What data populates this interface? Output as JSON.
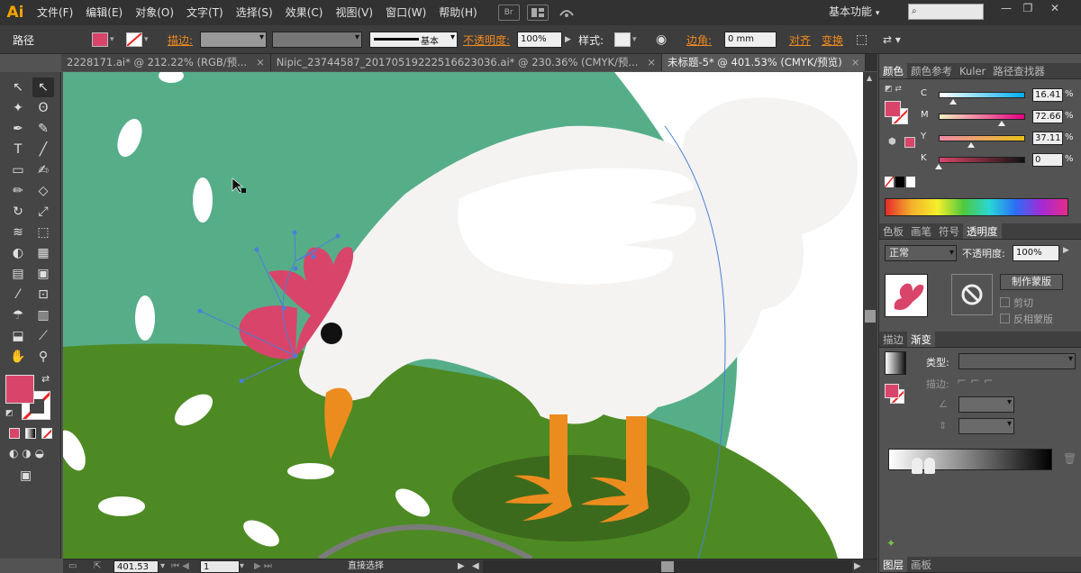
{
  "app": {
    "logo": "Ai"
  },
  "menu": [
    "文件(F)",
    "编辑(E)",
    "对象(O)",
    "文字(T)",
    "选择(S)",
    "效果(C)",
    "视图(V)",
    "窗口(W)",
    "帮助(H)"
  ],
  "menu_icons": {
    "bridge": "Br",
    "arrange": "arrange-icon",
    "sync": "sync-icon"
  },
  "workspace": {
    "label": "基本功能",
    "chevron": "▾"
  },
  "search": {
    "glyph": "⌕"
  },
  "window_controls": {
    "minimize": "—",
    "restore": "❐",
    "close": "✕"
  },
  "control_bar": {
    "object_type": "路径",
    "stroke_label": "描边:",
    "brush_style": "基本",
    "opacity_label": "不透明度:",
    "opacity_value": "100%",
    "style_label": "样式:",
    "corner_label": "边角:",
    "corner_value": "0 mm",
    "align_label": "对齐",
    "transform_label": "变换",
    "fill_color": "#d9456a"
  },
  "tabs": [
    {
      "label": "2228171.ai* @ 212.22% (RGB/预...",
      "close": "×"
    },
    {
      "label": "Nipic_23744587_20170519222516623036.ai* @ 230.36% (CMYK/预...",
      "close": "×"
    },
    {
      "label": "未标题-5* @ 401.53% (CMYK/预览)",
      "close": "×"
    }
  ],
  "active_tab": 2,
  "tools": [
    "selection-tool",
    "direct-selection-tool",
    "magic-wand-tool",
    "lasso-tool",
    "pen-tool",
    "curvature-tool",
    "type-tool",
    "line-tool",
    "rectangle-tool",
    "paintbrush-tool",
    "pencil-tool",
    "eraser-tool",
    "rotate-tool",
    "scale-tool",
    "width-tool",
    "free-transform-tool",
    "shape-builder-tool",
    "perspective-tool",
    "mesh-tool",
    "gradient-tool",
    "eyedropper-tool",
    "blend-tool",
    "symbol-sprayer-tool",
    "column-graph-tool",
    "artboard-tool",
    "slice-tool",
    "hand-tool",
    "zoom-tool"
  ],
  "tool_glyphs": [
    "↖",
    "↖",
    "✦",
    "ʘ",
    "✒",
    "✎",
    "T",
    "╱",
    "▭",
    "✍",
    "✏",
    "◇",
    "↻",
    "⤢",
    "≋",
    "⬚",
    "◐",
    "▦",
    "▤",
    "▣",
    "⁄",
    "⊡",
    "☂",
    "▥",
    "⬓",
    "⟋",
    "✋",
    "⚲"
  ],
  "colors": {
    "fill": "#d9456a",
    "teal": "#56ae89",
    "grass": "#4d8a24",
    "shadow": "#3c6a1c",
    "hen": "#f4f3f2",
    "comb": "#d9456a",
    "beak": "#ec8c1f",
    "feet": "#ec8c1f"
  },
  "status_bar": {
    "zoom": "401.53",
    "page": "1",
    "tool_name": "直接选择"
  },
  "color_panel": {
    "tabs": [
      "颜色",
      "颜色参考",
      "Kuler",
      "路径查找器"
    ],
    "channels": [
      {
        "label": "C",
        "value": "16.41",
        "unit": "%",
        "fraction": 0.164
      },
      {
        "label": "M",
        "value": "72.66",
        "unit": "%",
        "fraction": 0.727
      },
      {
        "label": "Y",
        "value": "37.11",
        "unit": "%",
        "fraction": 0.371
      },
      {
        "label": "K",
        "value": "0",
        "unit": "%",
        "fraction": 0.0
      }
    ]
  },
  "transparency_panel": {
    "tabs": [
      "色板",
      "画笔",
      "符号",
      "透明度"
    ],
    "blend_mode": "正常",
    "opacity_label": "不透明度:",
    "opacity_value": "100%",
    "make_mask_button": "制作蒙版",
    "clip_label": "剪切",
    "invert_label": "反相蒙版"
  },
  "gradient_panel": {
    "tabs": [
      "描边",
      "渐变"
    ],
    "type_label": "类型:",
    "stroke_label": "描边:"
  },
  "layers_panel": {
    "tabs": [
      "图层",
      "画板"
    ]
  }
}
